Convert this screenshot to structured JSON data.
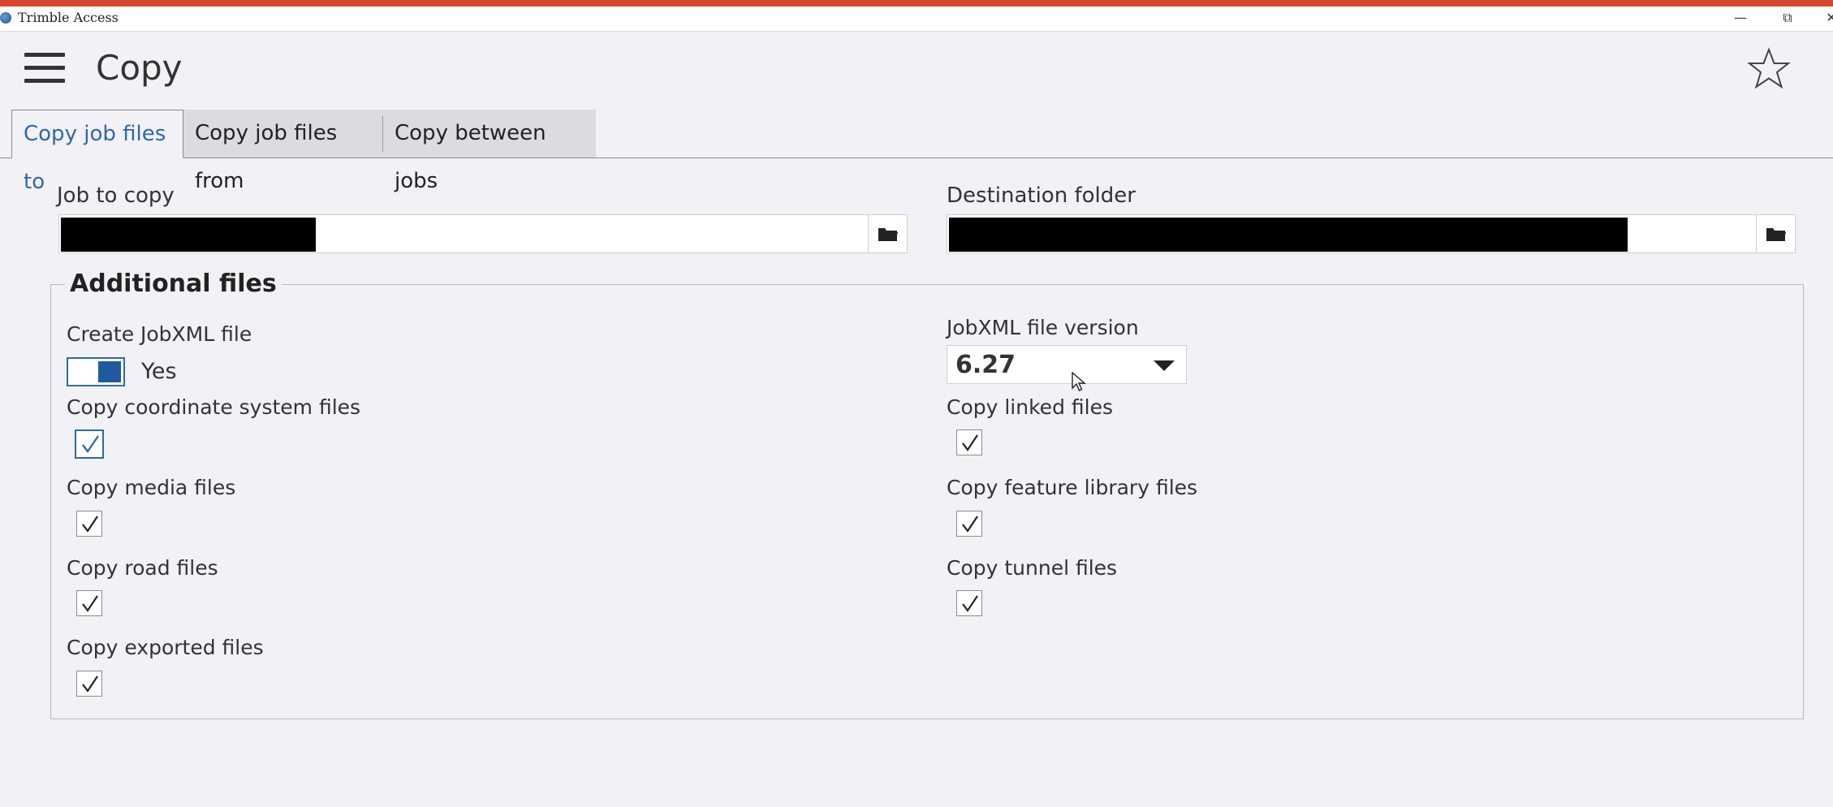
{
  "window": {
    "title": "Trimble Access",
    "minimize": "—",
    "restore": "⧉",
    "close": "✕"
  },
  "colors": {
    "accent_bar": "#d9452f",
    "active_tab": "#2f6aa8",
    "toggle_on": "#1f5aa0",
    "background": "#f2f1f6"
  },
  "header": {
    "title": "Copy",
    "menu_icon": "hamburger-menu-icon",
    "favorite_icon": "star-outline-icon"
  },
  "tabs": [
    {
      "label": "Copy job files to",
      "active": true
    },
    {
      "label": "Copy job files from",
      "active": false
    },
    {
      "label": "Copy between jobs",
      "active": false
    }
  ],
  "form": {
    "job_to_copy": {
      "label": "Job to copy",
      "value": "",
      "icon": "folder-icon"
    },
    "destination_folder": {
      "label": "Destination folder",
      "value": "",
      "icon": "folder-icon"
    }
  },
  "additional_files": {
    "title": "Additional files",
    "create_jobxml": {
      "label": "Create JobXML file",
      "value": "Yes",
      "on": true
    },
    "jobxml_version": {
      "label": "JobXML file version",
      "value": "6.27"
    },
    "options": [
      {
        "label": "Copy coordinate system files",
        "checked": true
      },
      {
        "label": "Copy linked files",
        "checked": true
      },
      {
        "label": "Copy media files",
        "checked": true
      },
      {
        "label": "Copy feature library files",
        "checked": true
      },
      {
        "label": "Copy road files",
        "checked": true
      },
      {
        "label": "Copy tunnel files",
        "checked": true
      },
      {
        "label": "Copy exported files",
        "checked": true
      }
    ]
  }
}
